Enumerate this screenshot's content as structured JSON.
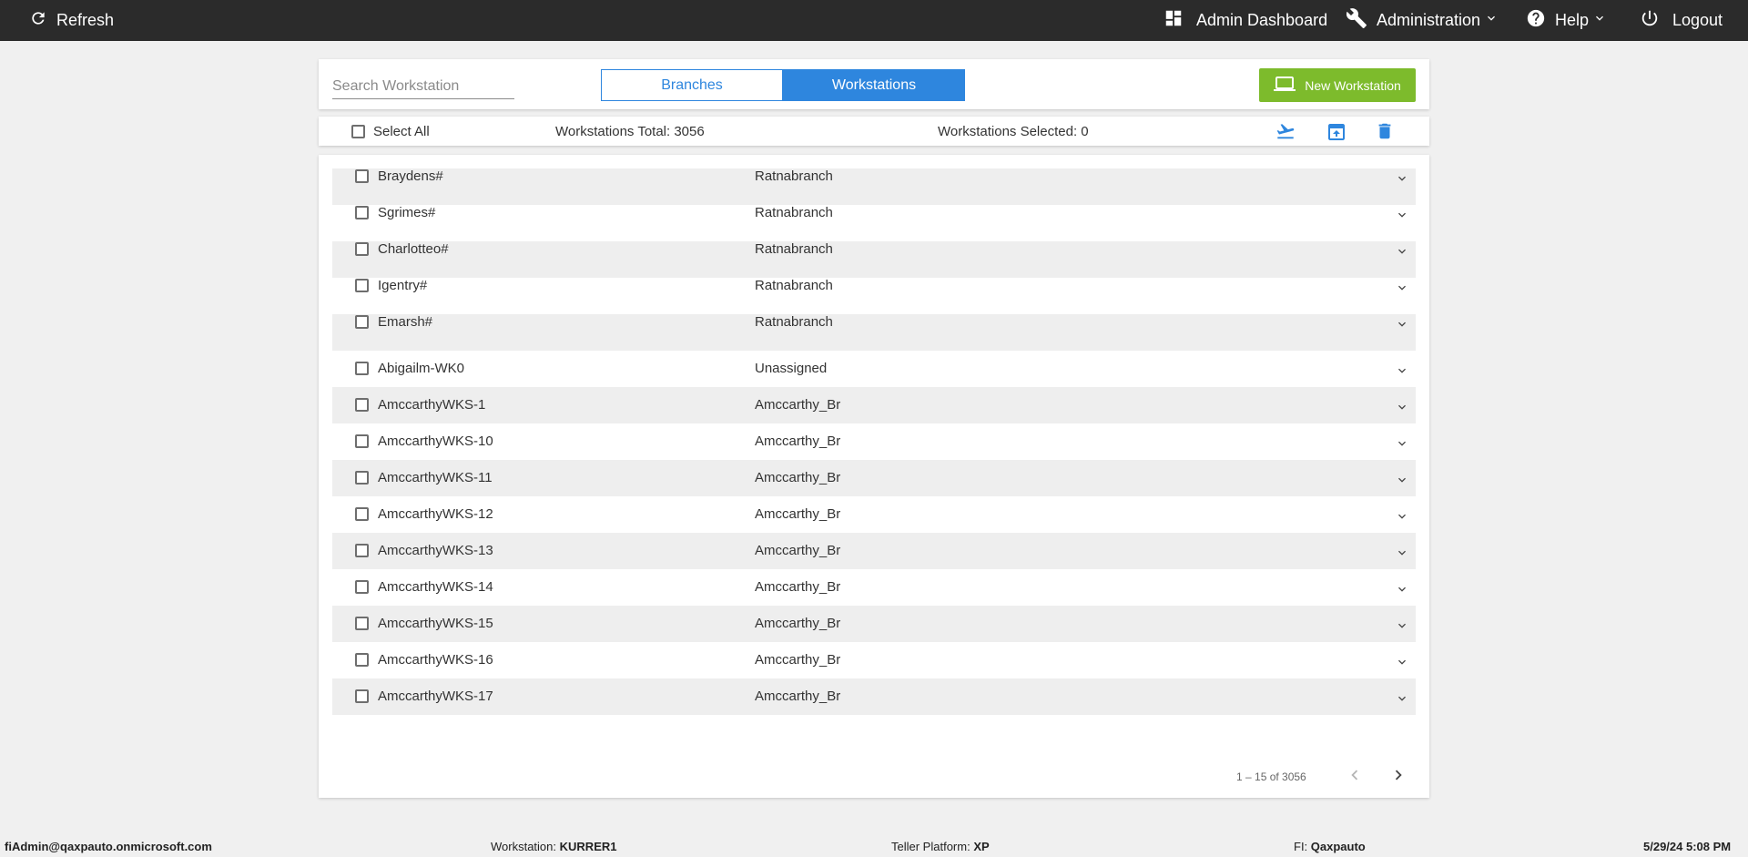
{
  "topbar": {
    "refresh_label": "Refresh",
    "dashboard_label": "Admin Dashboard",
    "administration_label": "Administration",
    "help_label": "Help",
    "logout_label": "Logout"
  },
  "header": {
    "search_placeholder": "Search Workstation",
    "tab_branches": "Branches",
    "tab_workstations": "Workstations",
    "active_tab": "Workstations",
    "new_button_label": "New Workstation",
    "accent_color": "#2e86de",
    "new_button_color": "#7dbb2c"
  },
  "toolbar": {
    "select_all_label": "Select All",
    "total_text": "Workstations Total: 3056",
    "selected_text": "Workstations Selected: 0",
    "icons": [
      "move-workstation-icon",
      "upload-icon",
      "delete-icon"
    ]
  },
  "rows": [
    {
      "name": "Braydens#",
      "branch": "Ratnabranch"
    },
    {
      "name": "Sgrimes#",
      "branch": "Ratnabranch"
    },
    {
      "name": "Charlotteo#",
      "branch": "Ratnabranch"
    },
    {
      "name": "Igentry#",
      "branch": "Ratnabranch"
    },
    {
      "name": "Emarsh#",
      "branch": "Ratnabranch"
    },
    {
      "name": "Abigailm-WK0",
      "branch": "Unassigned"
    },
    {
      "name": "AmccarthyWKS-1",
      "branch": "Amccarthy_Br"
    },
    {
      "name": "AmccarthyWKS-10",
      "branch": "Amccarthy_Br"
    },
    {
      "name": "AmccarthyWKS-11",
      "branch": "Amccarthy_Br"
    },
    {
      "name": "AmccarthyWKS-12",
      "branch": "Amccarthy_Br"
    },
    {
      "name": "AmccarthyWKS-13",
      "branch": "Amccarthy_Br"
    },
    {
      "name": "AmccarthyWKS-14",
      "branch": "Amccarthy_Br"
    },
    {
      "name": "AmccarthyWKS-15",
      "branch": "Amccarthy_Br"
    },
    {
      "name": "AmccarthyWKS-16",
      "branch": "Amccarthy_Br"
    },
    {
      "name": "AmccarthyWKS-17",
      "branch": "Amccarthy_Br"
    }
  ],
  "pagination": {
    "range_text": "1 – 15 of 3056"
  },
  "footer": {
    "user": "fiAdmin@qaxpauto.onmicrosoft.com",
    "workstation_label": "Workstation:",
    "workstation_value": "KURRER1",
    "platform_label": "Teller Platform:",
    "platform_value": "XP",
    "fi_label": "FI:",
    "fi_value": "Qaxpauto",
    "datetime": "5/29/24 5:08 PM"
  }
}
